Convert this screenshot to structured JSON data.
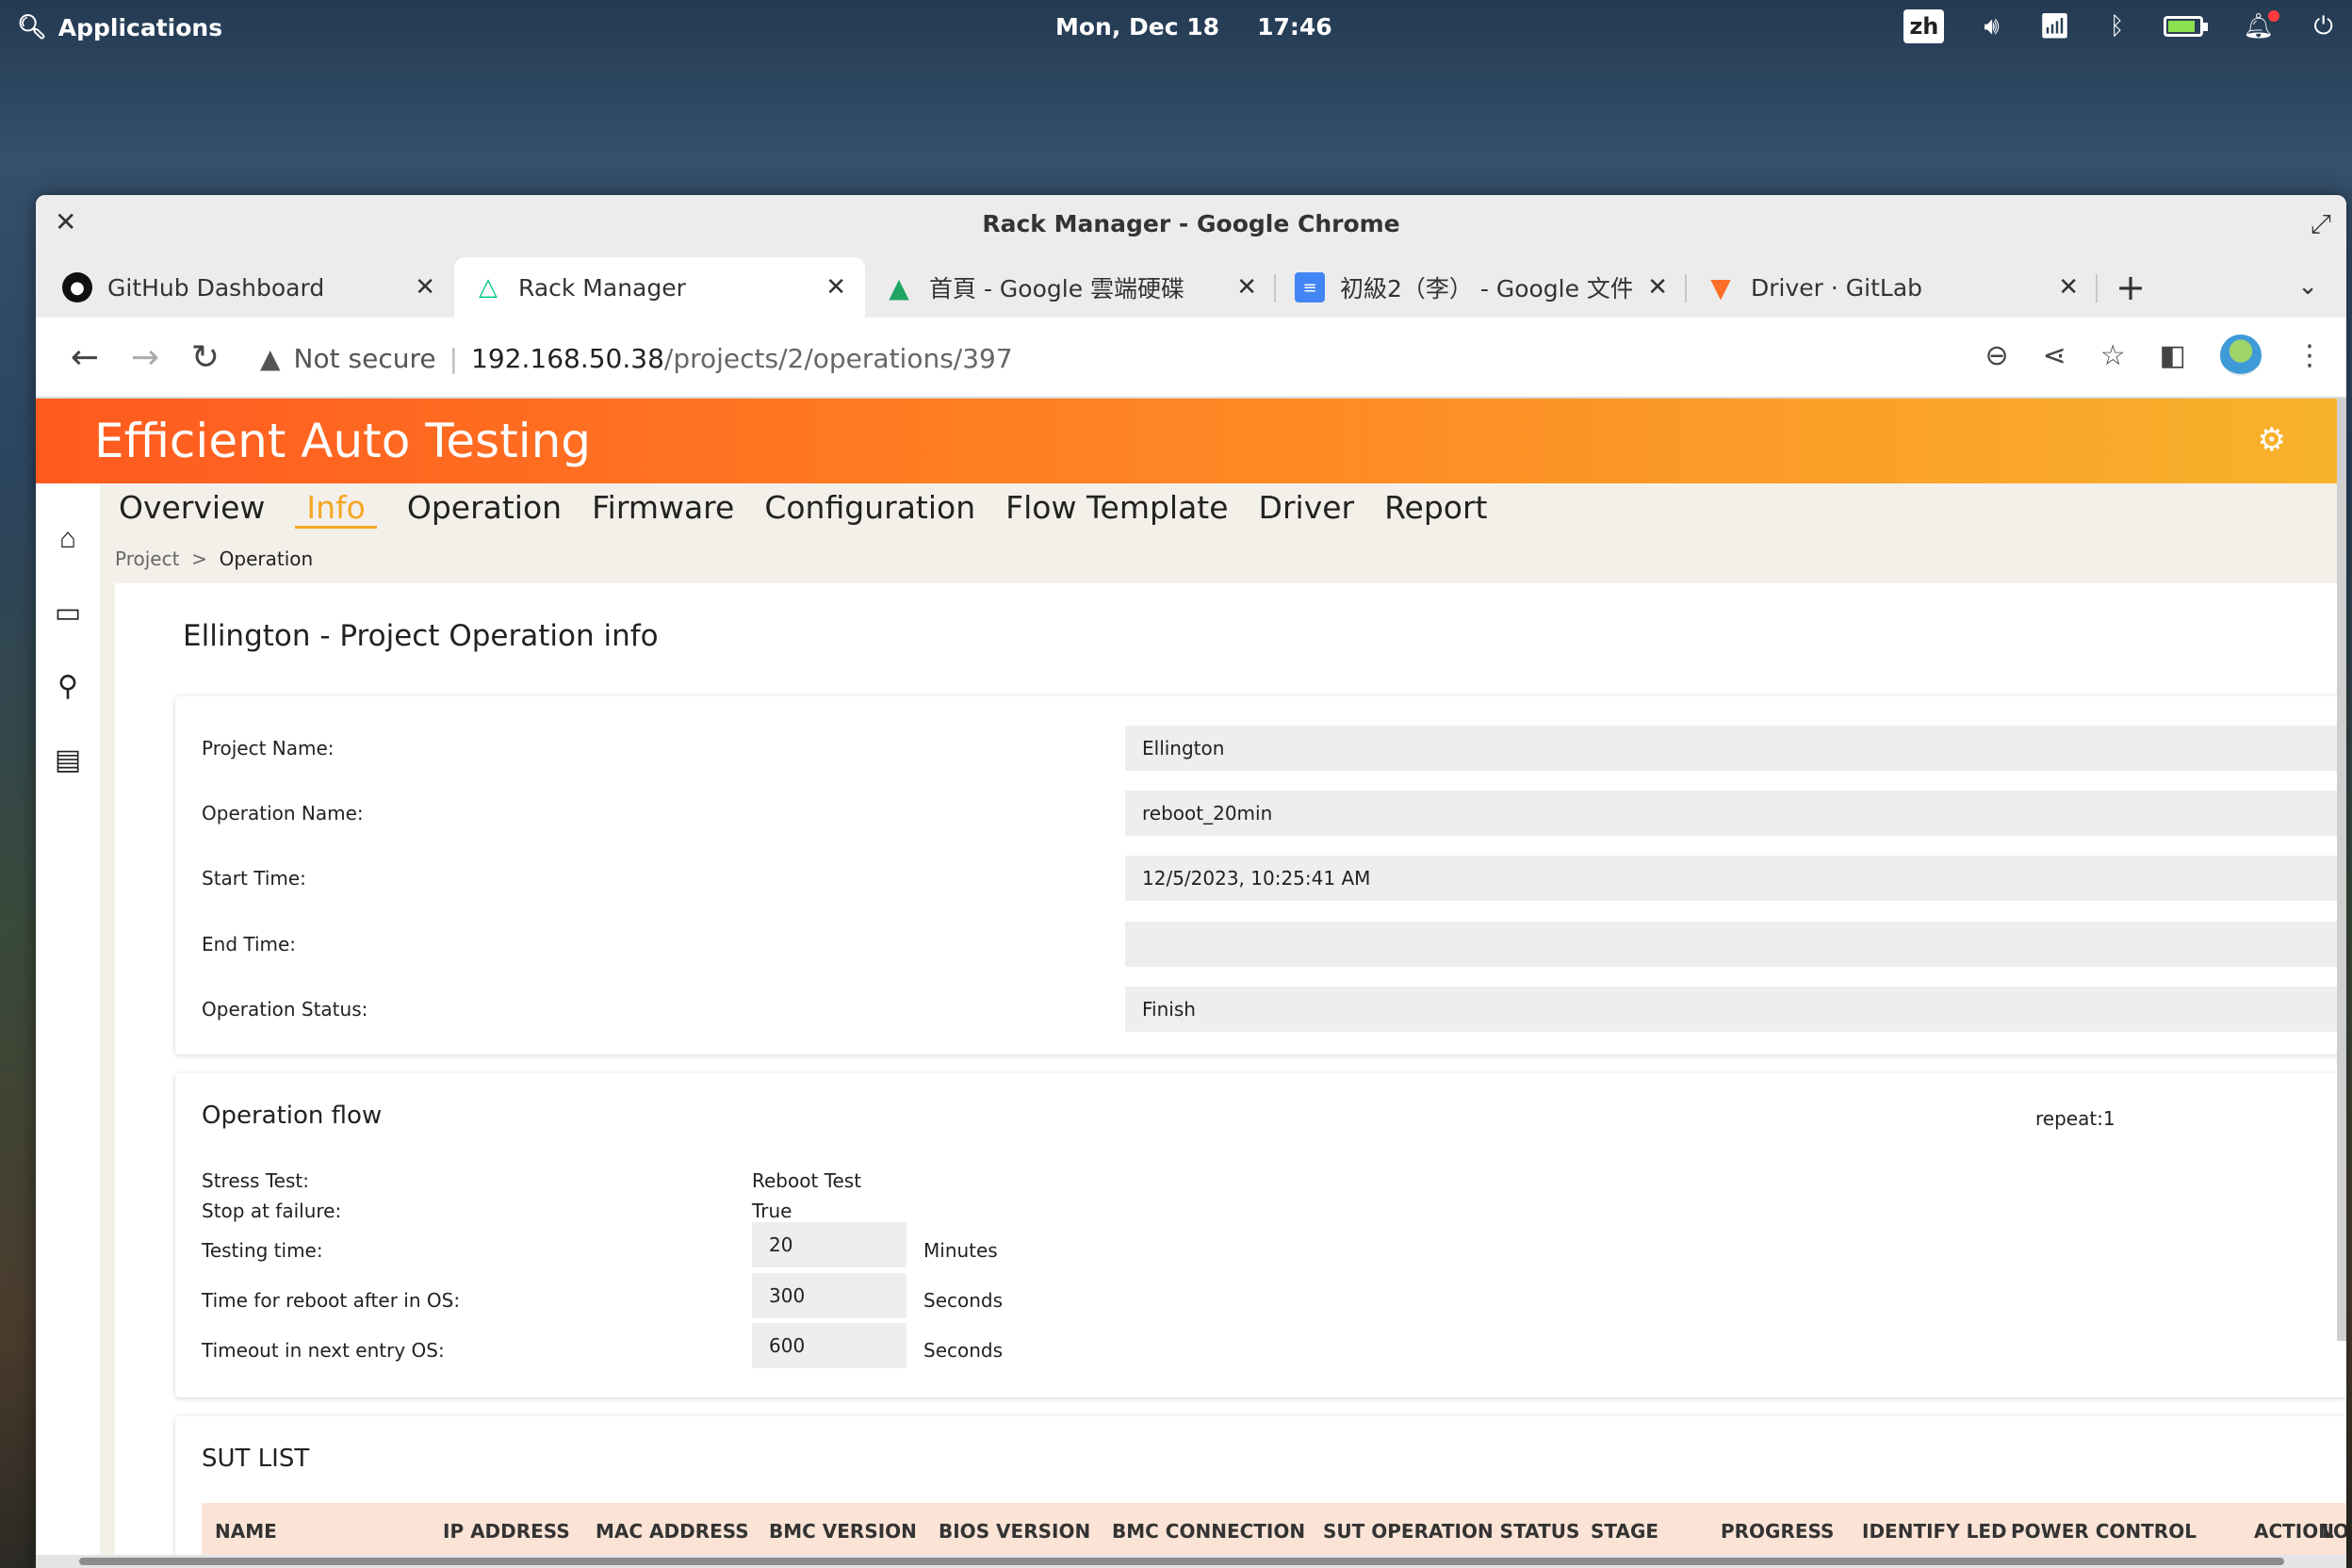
{
  "desktop": {
    "apps_label": "Applications",
    "date": "Mon, Dec 18",
    "time": "17:46",
    "ime": "zh",
    "battery_level": 0.85
  },
  "window": {
    "title": "Rack Manager - Google Chrome"
  },
  "tabs": [
    {
      "label": "GitHub Dashboard",
      "icon": "github-icon"
    },
    {
      "label": "Rack Manager",
      "icon": "nuxt-icon",
      "active": true
    },
    {
      "label": "首頁 - Google 雲端硬碟",
      "icon": "google-drive-icon"
    },
    {
      "label": "初級2（李） - Google 文件",
      "icon": "google-docs-icon"
    },
    {
      "label": "Driver · GitLab",
      "icon": "gitlab-icon"
    }
  ],
  "address": {
    "security": "Not secure",
    "host": "192.168.50.38",
    "path": "/projects/2/operations/397"
  },
  "app": {
    "brand": "Efficient Auto Testing",
    "menu": [
      "Overview",
      "Info",
      "Operation",
      "Firmware",
      "Configuration",
      "Flow Template",
      "Driver",
      "Report"
    ],
    "active_menu": "Info",
    "breadcrumb": {
      "parent": "Project",
      "separator": ">",
      "current": "Operation"
    }
  },
  "info": {
    "title": "Ellington - Project Operation info",
    "rows": [
      {
        "label": "Project Name:",
        "value": "Ellington"
      },
      {
        "label": "Operation Name:",
        "value": "reboot_20min"
      },
      {
        "label": "Start Time:",
        "value": "12/5/2023, 10:25:41 AM"
      },
      {
        "label": "End Time:",
        "value": ""
      },
      {
        "label": "Operation Status:",
        "value": "Finish"
      }
    ]
  },
  "flow": {
    "title": "Operation flow",
    "repeat": "repeat:1",
    "stress_label": "Stress Test:",
    "stress_value": "Reboot Test",
    "stop_label": "Stop at failure:",
    "stop_value": "True",
    "testing_label": "Testing time:",
    "testing_value": "20",
    "testing_unit": "Minutes",
    "reboot_label": "Time for reboot after in OS:",
    "reboot_value": "300",
    "reboot_unit": "Seconds",
    "timeout_label": "Timeout in next entry OS:",
    "timeout_value": "600",
    "timeout_unit": "Seconds"
  },
  "sut": {
    "title": "SUT LIST",
    "columns": [
      "NAME",
      "IP ADDRESS",
      "MAC ADDRESS",
      "BMC VERSION",
      "BIOS VERSION",
      "BMC CONNECTION",
      "SUT OPERATION STATUS",
      "STAGE",
      "PROGRESS",
      "IDENTIFY LED",
      "POWER CONTROL",
      "ACTION",
      "LO"
    ]
  }
}
